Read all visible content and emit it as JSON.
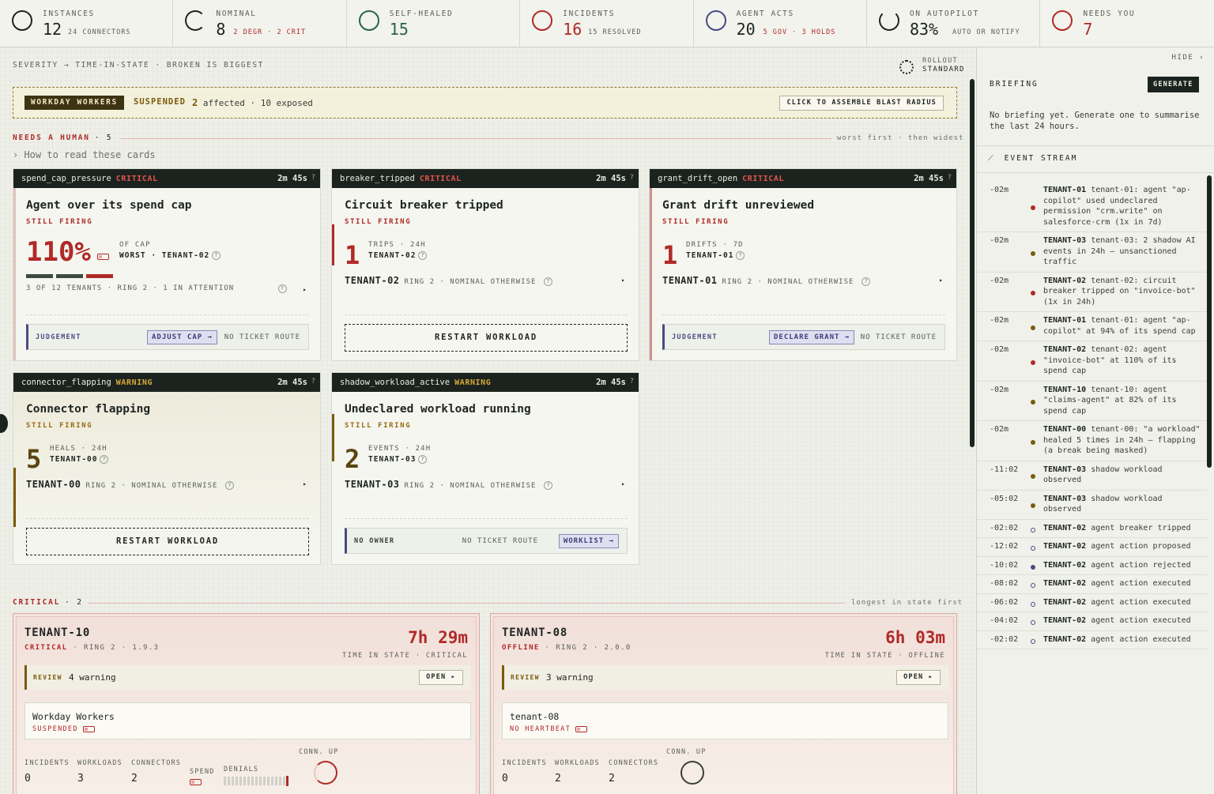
{
  "stats": [
    {
      "label": "INSTANCES",
      "value": "12",
      "sub": "24 CONNECTORS",
      "ring": "#1e2420",
      "num_color": "#1e2420",
      "sub_color": "#5a6058"
    },
    {
      "label": "NOMINAL",
      "value": "8",
      "sub": "2 DEGR · 2 CRIT",
      "ring": "#1e2420",
      "num_color": "#1e2420",
      "sub_color": "#b02a27"
    },
    {
      "label": "SELF-HEALED",
      "value": "15",
      "sub": "",
      "ring": "#27634e",
      "num_color": "#27634e",
      "sub_color": "#5a6058"
    },
    {
      "label": "INCIDENTS",
      "value": "16",
      "sub": "15 RESOLVED",
      "ring": "#b02a27",
      "num_color": "#b02a27",
      "sub_color": "#5a6058"
    },
    {
      "label": "AGENT ACTS",
      "value": "20",
      "sub": "5 GOV · 3 HOLDS",
      "ring": "#4a4a85",
      "num_color": "#1e2420",
      "sub_color": "#b02a27"
    },
    {
      "label": "ON AUTOPILOT",
      "value": "83%",
      "sub": "AUTO OR NOTIFY",
      "ring": "#1e2420",
      "num_color": "#1e2420",
      "sub_color": "#5a6058"
    },
    {
      "label": "NEEDS YOU",
      "value": "7",
      "sub": "",
      "ring": "#b02a27",
      "num_color": "#b02a27",
      "sub_color": "#5a6058"
    }
  ],
  "top_hint": "SEVERITY → TIME-IN-STATE · BROKEN IS BIGGEST",
  "rollout": {
    "label": "ROLLOUT",
    "value": "STANDARD"
  },
  "banner": {
    "tag": "WORKDAY WORKERS",
    "state": "SUSPENDED",
    "affected_count": "2",
    "affected_text": "affected · 10 exposed",
    "button": "CLICK TO ASSEMBLE BLAST RADIUS"
  },
  "needs_human": {
    "label": "NEEDS A HUMAN",
    "count": "· 5",
    "right": "worst first · then widest",
    "howto": "› How to read these cards"
  },
  "alerts": [
    {
      "code": "spend_cap_pressure",
      "severity": "CRITICAL",
      "age": "2m 45s",
      "q": "?",
      "title": "Agent over its spend cap",
      "still": "STILL FIRING",
      "big": "110%",
      "m1": "OF CAP",
      "m2": "WORST · TENANT-02",
      "tline": "3 OF 12 TENANTS · RING 2 · 1 IN ATTENTION",
      "arrow": "▸",
      "action_label": "JUDGEMENT",
      "action_btn": "ADJUST CAP →",
      "action_note": "NO TICKET ROUTE"
    },
    {
      "code": "breaker_tripped",
      "severity": "CRITICAL",
      "age": "2m 45s",
      "q": "?",
      "title": "Circuit breaker tripped",
      "still": "STILL FIRING",
      "big": "1",
      "m1": "TRIPS · 24H",
      "m2": "TENANT-02",
      "tenant": "TENANT-02",
      "tline": "RING 2 · NOMINAL OTHERWISE",
      "arrow": "▸",
      "action": "RESTART WORKLOAD"
    },
    {
      "code": "grant_drift_open",
      "severity": "CRITICAL",
      "age": "2m 45s",
      "q": "?",
      "title": "Grant drift unreviewed",
      "still": "STILL FIRING",
      "big": "1",
      "m1": "DRIFTS · 7D",
      "m2": "TENANT-01",
      "tenant": "TENANT-01",
      "tline": "RING 2 · NOMINAL OTHERWISE",
      "arrow": "▸",
      "action_label": "JUDGEMENT",
      "action_btn": "DECLARE GRANT →",
      "action_note": "NO TICKET ROUTE"
    },
    {
      "code": "connector_flapping",
      "severity": "WARNING",
      "age": "2m 45s",
      "q": "?",
      "title": "Connector flapping",
      "still": "STILL FIRING",
      "big": "5",
      "m1": "HEALS · 24H",
      "m2": "TENANT-00",
      "tenant": "TENANT-00",
      "tline": "RING 2 · NOMINAL OTHERWISE",
      "arrow": "▸",
      "action": "RESTART WORKLOAD"
    },
    {
      "code": "shadow_workload_active",
      "severity": "WARNING",
      "age": "2m 45s",
      "q": "?",
      "title": "Undeclared workload running",
      "still": "STILL FIRING",
      "big": "2",
      "m1": "EVENTS · 24H",
      "m2": "TENANT-03",
      "tenant": "TENANT-03",
      "tline": "RING 2 · NOMINAL OTHERWISE",
      "arrow": "▸",
      "action_label": "NO OWNER",
      "action_note2": "NO TICKET ROUTE",
      "action_btn": "WORKLIST →"
    }
  ],
  "critical": {
    "label": "CRITICAL",
    "count": "· 2",
    "right": "longest in state first"
  },
  "tenants": [
    {
      "name": "TENANT-10",
      "status": "CRITICAL",
      "meta": " · RING 2 · 1.9.3",
      "tis": "7h 29m",
      "tis_label": "TIME IN STATE · CRITICAL",
      "review_label": "REVIEW",
      "review_text": "4 warning",
      "review_btn": "OPEN ▸",
      "work_name": "Workday Workers",
      "work_state": "SUSPENDED",
      "m_incidents": "INCIDENTS",
      "v_incidents": "0",
      "m_workloads": "WORKLOADS",
      "v_workloads": "3",
      "m_connectors": "CONNECTORS",
      "v_connectors": "2",
      "m_spend": "SPEND",
      "m_denials": "DENIALS",
      "conn_label": "CONN. UP"
    },
    {
      "name": "TENANT-08",
      "status": "OFFLINE",
      "meta": " · RING 2 · 2.0.0",
      "tis": "6h 03m",
      "tis_label": "TIME IN STATE · OFFLINE",
      "review_label": "REVIEW",
      "review_text": "3 warning",
      "review_btn": "OPEN ▸",
      "work_name": "tenant-08",
      "work_state": "NO HEARTBEAT",
      "m_incidents": "INCIDENTS",
      "v_incidents": "0",
      "m_workloads": "WORKLOADS",
      "v_workloads": "2",
      "m_connectors": "CONNECTORS",
      "v_connectors": "2",
      "conn_label": "CONN. UP"
    }
  ],
  "sidebar": {
    "hide": "HIDE ›",
    "briefing": "BRIEFING",
    "generate": "GENERATE",
    "briefing_text": "No briefing yet. Generate one to summarise the last 24 hours.",
    "event_stream": "EVENT STREAM",
    "events": [
      {
        "t": "-02m",
        "dot": "red",
        "tenant": "TENANT-01",
        "text": " tenant-01: agent \"ap-copilot\" used undeclared permission \"crm.write\" on salesforce-crm (1x in 7d)"
      },
      {
        "t": "-02m",
        "dot": "amber",
        "tenant": "TENANT-03",
        "text": " tenant-03: 2 shadow AI events in 24h — unsanctioned traffic"
      },
      {
        "t": "-02m",
        "dot": "red",
        "tenant": "TENANT-02",
        "text": " tenant-02: circuit breaker tripped on \"invoice-bot\" (1x in 24h)"
      },
      {
        "t": "-02m",
        "dot": "amber",
        "tenant": "TENANT-01",
        "text": " tenant-01: agent \"ap-copilot\" at 94% of its spend cap"
      },
      {
        "t": "-02m",
        "dot": "red",
        "tenant": "TENANT-02",
        "text": " tenant-02: agent \"invoice-bot\" at 110% of its spend cap"
      },
      {
        "t": "-02m",
        "dot": "amber",
        "tenant": "TENANT-10",
        "text": " tenant-10: agent \"claims-agent\" at 82% of its spend cap"
      },
      {
        "t": "-02m",
        "dot": "amber",
        "tenant": "TENANT-00",
        "text": " tenant-00: \"a workload\" healed 5 times in 24h — flapping (a break being masked)"
      },
      {
        "t": "-11:02",
        "dot": "amber",
        "tenant": "TENANT-03",
        "text": " shadow workload observed"
      },
      {
        "t": "-05:02",
        "dot": "amber",
        "tenant": "TENANT-03",
        "text": " shadow workload observed"
      },
      {
        "t": "-02:02",
        "dot": "hollow",
        "tenant": "TENANT-02",
        "text": " agent breaker tripped"
      },
      {
        "t": "-12:02",
        "dot": "hollow",
        "tenant": "TENANT-02",
        "text": " agent action proposed"
      },
      {
        "t": "-10:02",
        "dot": "violet",
        "tenant": "TENANT-02",
        "text": " agent action rejected"
      },
      {
        "t": "-08:02",
        "dot": "hollow",
        "tenant": "TENANT-02",
        "text": " agent action executed"
      },
      {
        "t": "-06:02",
        "dot": "hollow",
        "tenant": "TENANT-02",
        "text": " agent action executed"
      },
      {
        "t": "-04:02",
        "dot": "hollow",
        "tenant": "TENANT-02",
        "text": " agent action executed"
      },
      {
        "t": "-02:02",
        "dot": "hollow",
        "tenant": "TENANT-02",
        "text": " agent action executed"
      }
    ]
  }
}
